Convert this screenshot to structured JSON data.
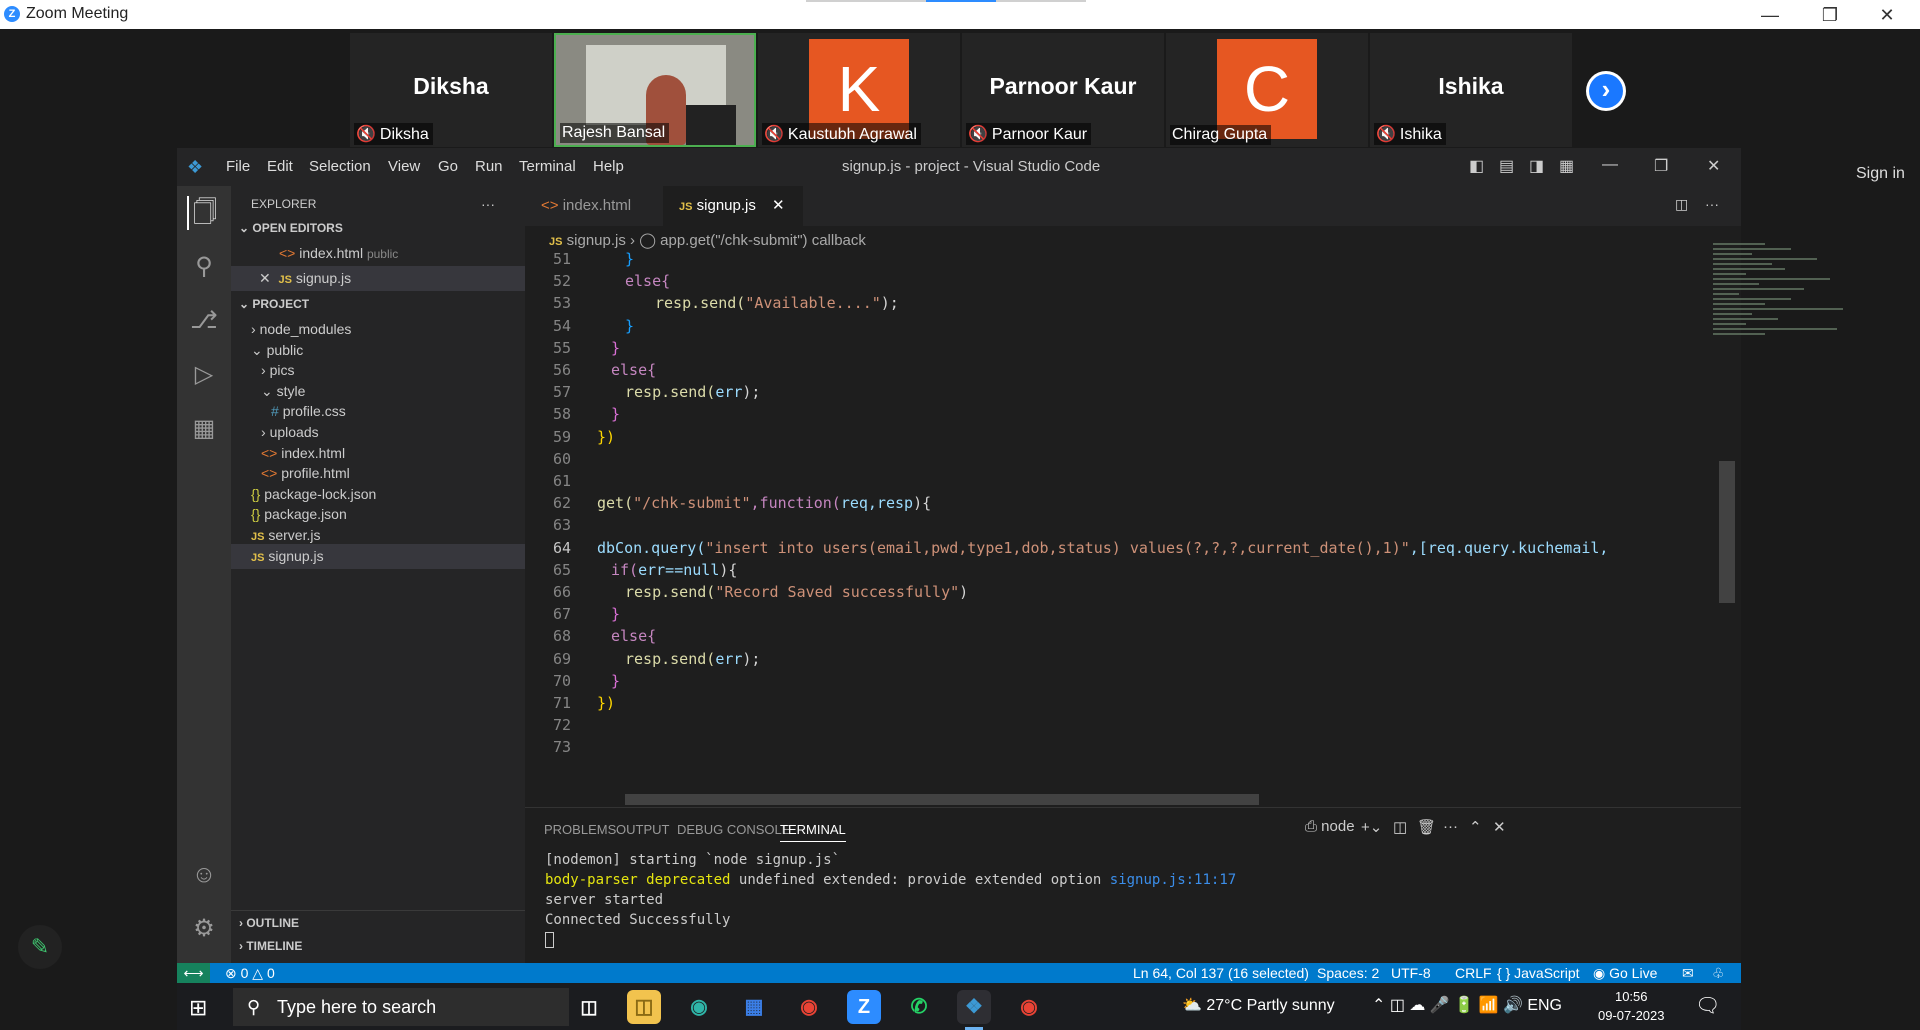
{
  "zoom": {
    "title": "Zoom Meeting",
    "sign_in": "Sign in",
    "participants": [
      {
        "display": "Diksha",
        "label": "Diksha",
        "type": "name"
      },
      {
        "display": "",
        "label": "Rajesh Bansal",
        "type": "video"
      },
      {
        "display": "K",
        "label": "Kaustubh Agrawal",
        "type": "avatar"
      },
      {
        "display": "Parnoor Kaur",
        "label": "Parnoor Kaur",
        "type": "name"
      },
      {
        "display": "C",
        "label": "Chirag Gupta",
        "type": "avatar"
      },
      {
        "display": "Ishika",
        "label": "Ishika",
        "type": "name"
      }
    ]
  },
  "vscode": {
    "window_title": "signup.js - project - Visual Studio Code",
    "menu": [
      "File",
      "Edit",
      "Selection",
      "View",
      "Go",
      "Run",
      "Terminal",
      "Help"
    ],
    "explorer_label": "EXPLORER",
    "open_editors_label": "OPEN EDITORS",
    "open_editors": [
      {
        "name": "index.html",
        "hint": "public"
      },
      {
        "name": "signup.js",
        "hint": ""
      }
    ],
    "project_label": "PROJECT",
    "tree": [
      {
        "name": "node_modules",
        "kind": "folder-closed"
      },
      {
        "name": "public",
        "kind": "folder-open"
      },
      {
        "name": "pics",
        "kind": "folder-closed"
      },
      {
        "name": "style",
        "kind": "folder-open"
      },
      {
        "name": "profile.css",
        "kind": "css"
      },
      {
        "name": "uploads",
        "kind": "folder-closed"
      },
      {
        "name": "index.html",
        "kind": "html"
      },
      {
        "name": "profile.html",
        "kind": "html"
      },
      {
        "name": "package-lock.json",
        "kind": "json"
      },
      {
        "name": "package.json",
        "kind": "json"
      },
      {
        "name": "server.js",
        "kind": "js"
      },
      {
        "name": "signup.js",
        "kind": "js"
      }
    ],
    "outline_label": "OUTLINE",
    "timeline_label": "TIMELINE",
    "tabs": [
      {
        "name": "index.html",
        "active": false
      },
      {
        "name": "signup.js",
        "active": true
      }
    ],
    "breadcrumb": {
      "file": "signup.js",
      "symbol": "app.get(\"/chk-submit\") callback"
    },
    "line_numbers": [
      "51",
      "52",
      "53",
      "54",
      "55",
      "56",
      "57",
      "58",
      "59",
      "60",
      "61",
      "62",
      "63",
      "64",
      "65",
      "66",
      "67",
      "68",
      "69",
      "70",
      "71",
      "72",
      "73"
    ],
    "code": {
      "l51": "}",
      "l52": "else{",
      "l53a": "resp.send(",
      "l53b": "\"Available....\"",
      "l53c": ");",
      "l54": "}",
      "l55": "}",
      "l56": "else{",
      "l57a": "resp.send(",
      "l57b": "err",
      "l57c": ");",
      "l58": "}",
      "l59": "})",
      "l62a": "get(",
      "l62b": "\"/chk-submit\"",
      "l62c": ",function(",
      "l62d": "req,resp",
      "l62e": "){",
      "l64a": "dbCon.query(",
      "l64b": "\"insert into users(email,pwd,type1,dob,status) values(?,?,?,current_date(),1)\"",
      "l64c": ",[req.query.kuchemail,",
      "l65a": "if(",
      "l65b": "err==null",
      "l65c": "){",
      "l66a": "resp.send(",
      "l66b": "\"Record Saved successfully\"",
      "l66c": ")",
      "l67": "}",
      "l68": "else{",
      "l69a": "resp.send(",
      "l69b": "err",
      "l69c": ");",
      "l70": "}",
      "l71": "})"
    },
    "panel_tabs": [
      "PROBLEMS",
      "OUTPUT",
      "DEBUG CONSOLE",
      "TERMINAL"
    ],
    "terminal_shell": "node",
    "terminal": {
      "line1": "[nodemon] starting `node signup.js`",
      "line2a": "body-parser",
      "line2b": "deprecated",
      "line2c": "undefined extended: provide extended option",
      "line2d": "signup.js:11:17",
      "line3": "server started",
      "line4": "Connected Successfully"
    },
    "status": {
      "errors": "0",
      "warnings": "0",
      "position": "Ln 64, Col 137 (16 selected)",
      "spaces": "Spaces: 2",
      "encoding": "UTF-8",
      "eol": "CRLF",
      "language": "JavaScript",
      "golive": "Go Live"
    }
  },
  "taskbar": {
    "search_placeholder": "Type here to search",
    "weather": "27°C  Partly sunny",
    "lang": "ENG",
    "time": "10:56",
    "date": "09-07-2023"
  }
}
